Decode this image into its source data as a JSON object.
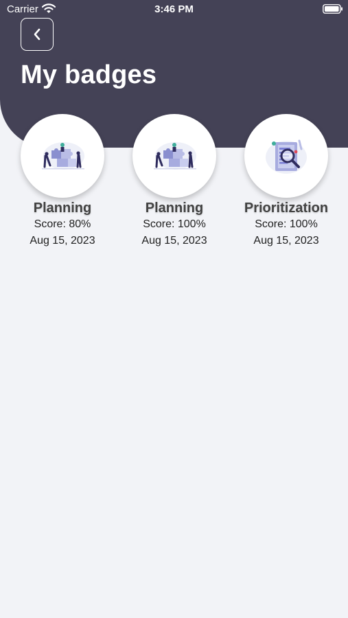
{
  "status_bar": {
    "carrier": "Carrier",
    "time": "3:46 PM",
    "wifi_icon": "wifi-icon",
    "battery_icon": "battery-icon"
  },
  "header": {
    "title": "My badges",
    "back_icon": "chevron-left-icon"
  },
  "colors": {
    "header_background": "#444256",
    "page_background": "#f2f3f7",
    "illustration_accent": "#7b7fd6"
  },
  "badges": [
    {
      "title": "Planning",
      "score": "Score: 80%",
      "date": "Aug 15, 2023",
      "icon": "puzzle-team-illustration"
    },
    {
      "title": "Planning",
      "score": "Score: 100%",
      "date": "Aug 15, 2023",
      "icon": "puzzle-team-illustration"
    },
    {
      "title": "Prioritization",
      "score": "Score: 100%",
      "date": "Aug 15, 2023",
      "icon": "magnifier-document-illustration"
    }
  ]
}
